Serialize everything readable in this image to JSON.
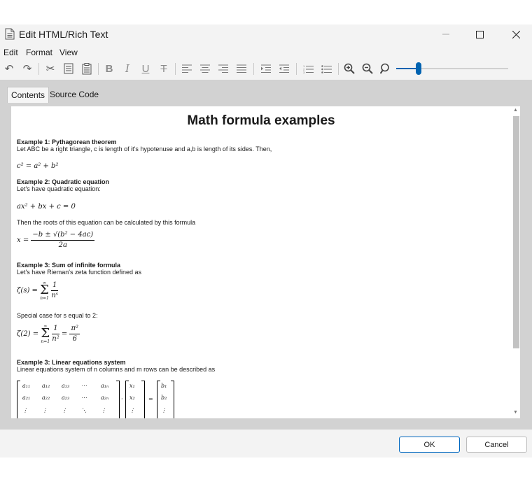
{
  "window": {
    "title": "Edit HTML/Rich Text"
  },
  "menu": [
    "Edit",
    "Format",
    "View"
  ],
  "tabs": [
    "Contents",
    "Source Code"
  ],
  "doc": {
    "title": "Math formula examples",
    "ex1_heading": "Example 1: Pythagorean theorem",
    "ex1_text": "Let ABC be a right triangle, c is length of it's hypotenuse and a,b is length of its sides. Then,",
    "ex1_formula": "c² = a² + b²",
    "ex2_heading": "Example 2: Quadratic equation",
    "ex2_text": "Let's have quadratic equation:",
    "ex2_formula": "ax² + bx + c = 0",
    "ex2_text2": "Then the roots of this equation can be calculated by this formula",
    "ex2_roots_lhs": "x =",
    "ex2_roots_num": "−b ± √(b² − 4ac)",
    "ex2_roots_den": "2a",
    "ex3_heading": "Example 3: Sum of infinite formula",
    "ex3_text": "Let's have Rieman's zeta function defined as",
    "ex3_lhs": "ζ(s) =",
    "ex3_sum_top": "∞",
    "ex3_sum_sig": "Σ",
    "ex3_sum_bot": "n=1",
    "ex3_num": "1",
    "ex3_den": "nˢ",
    "ex3_text2": "Special case for s equal to 2:",
    "ex3b_lhs": "ζ(2) =",
    "ex3b_den": "n²",
    "ex3b_eq": "=",
    "ex3b_num2": "π²",
    "ex3b_den2": "6",
    "ex4_heading": "Example 3: Linear equations system",
    "ex4_text": "Linear equations system of n columns and m rows can be described as",
    "matrix_a": [
      [
        "a₁₁",
        "a₁₂",
        "a₁₃",
        "⋯",
        "a₁ₙ"
      ],
      [
        "a₂₁",
        "a₂₂",
        "a₂₃",
        "⋯",
        "a₂ₙ"
      ],
      [
        "⋮",
        "⋮",
        "⋮",
        "⋱",
        "⋮"
      ]
    ],
    "vector_x": [
      "x₁",
      "x₂",
      "⋮"
    ],
    "vector_b": [
      "b₁",
      "b₂",
      "⋮"
    ],
    "dot": "·",
    "eq": "="
  },
  "buttons": {
    "ok": "OK",
    "cancel": "Cancel"
  },
  "zoom_slider_fraction": 0.2,
  "colors": {
    "accent": "#0063b1",
    "primary_border": "#0067c0"
  }
}
